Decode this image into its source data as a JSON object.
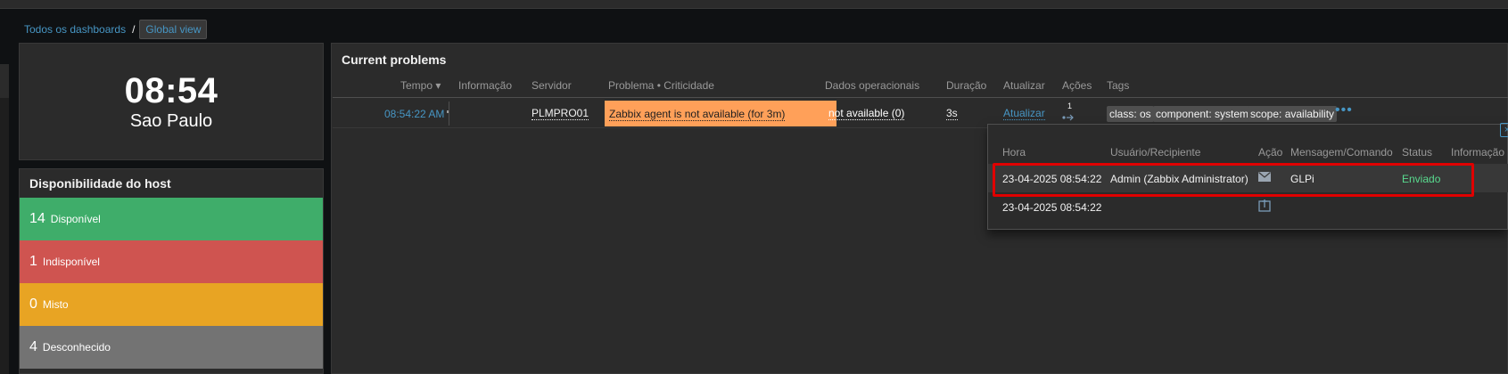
{
  "breadcrumb": {
    "link": "Todos os dashboards",
    "separator": "/",
    "current": "Global view"
  },
  "clock": {
    "time": "08:54",
    "city": "Sao Paulo"
  },
  "host_availability": {
    "title": "Disponibilidade do host",
    "rows": [
      {
        "count": "14",
        "label": "Disponível",
        "color": "#3fad6a"
      },
      {
        "count": "1",
        "label": "Indisponível",
        "color": "#cf5450"
      },
      {
        "count": "0",
        "label": "Misto",
        "color": "#e8a423"
      },
      {
        "count": "4",
        "label": "Desconhecido",
        "color": "#737373"
      }
    ]
  },
  "problems": {
    "title": "Current problems",
    "columns": {
      "time": "Tempo ▾",
      "info": "Informação",
      "host": "Servidor",
      "problem": "Problema • Criticidade",
      "opdata": "Dados operacionais",
      "duration": "Duração",
      "update": "Atualizar",
      "actions": "Ações",
      "tags": "Tags"
    },
    "rows": [
      {
        "time": "08:54:22 AM",
        "host": "PLMPRO01",
        "problem": "Zabbix agent is not available (for 3m)",
        "severity_color": "#ffa059",
        "opdata": "not available (0)",
        "duration": "3s",
        "update": "Atualizar",
        "actions_count": "1",
        "tags": [
          "class: os",
          "component: system",
          "scope: availability"
        ],
        "more": "•••"
      }
    ]
  },
  "actions_popup": {
    "columns": {
      "time": "Hora",
      "user": "Usuário/Recipiente",
      "action": "Ação",
      "message": "Mensagem/Comando",
      "status": "Status",
      "info": "Informação"
    },
    "rows": [
      {
        "time": "23-04-2025 08:54:22",
        "user": "Admin (Zabbix Administrator)",
        "action_icon": "envelope-icon",
        "message": "GLPi",
        "status": "Enviado",
        "status_color": "#59db8f"
      },
      {
        "time": "23-04-2025 08:54:22",
        "user": "",
        "action_icon": "problem-created-icon",
        "message": "",
        "status": ""
      }
    ],
    "close": "×"
  }
}
